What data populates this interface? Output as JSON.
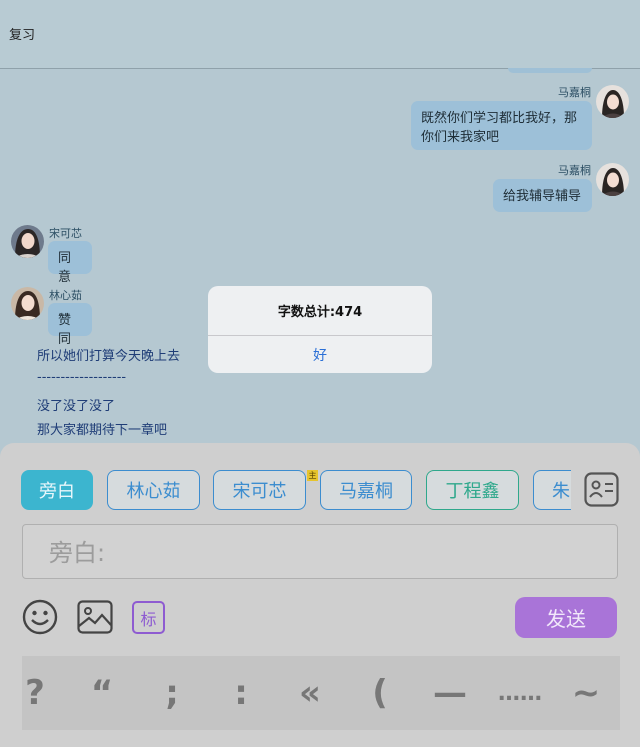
{
  "header": {
    "title": "复习"
  },
  "messages": [
    {
      "sender": "马嘉桐",
      "text_lines": [
        "既然你们学习都比我好，那",
        "你们来我家吧"
      ],
      "side": "right"
    },
    {
      "sender": "马嘉桐",
      "text_lines": [
        "给我辅导辅导"
      ],
      "side": "right"
    },
    {
      "sender": "宋可芯",
      "text_lines": [
        "同意"
      ],
      "side": "left"
    },
    {
      "sender": "林心茹",
      "text_lines": [
        "赞同"
      ],
      "side": "left"
    }
  ],
  "narration": [
    "所以她们打算今天晚上去",
    "-------------------",
    "没了没了没了",
    "那大家都期待下一章吧"
  ],
  "dialog": {
    "message": "字数总计:474",
    "ok_label": "好"
  },
  "composer": {
    "roles": [
      {
        "label": "旁白",
        "active": true,
        "color": "#3cb5cf"
      },
      {
        "label": "林心茹",
        "active": false,
        "color": "#3c8dcf"
      },
      {
        "label": "宋可芯",
        "active": false,
        "color": "#3c8dcf"
      },
      {
        "label": "马嘉桐",
        "active": false,
        "color": "#3c8dcf"
      },
      {
        "label": "丁程鑫",
        "active": false,
        "color": "#2fa88c"
      },
      {
        "label": "朱",
        "active": false,
        "color": "#3c8dcf"
      }
    ],
    "crown_badge": "主",
    "input_placeholder": "旁白:",
    "tag_label": "标",
    "send_label": "发送",
    "punctuation": [
      "?",
      "“",
      ";",
      ":",
      "«",
      "(",
      "—",
      "……",
      "~"
    ]
  },
  "colors": {
    "accent": "#3cb5cf",
    "send": "#a974d8",
    "bubble": "#9dc0d8",
    "background": "#b5c8d1"
  }
}
